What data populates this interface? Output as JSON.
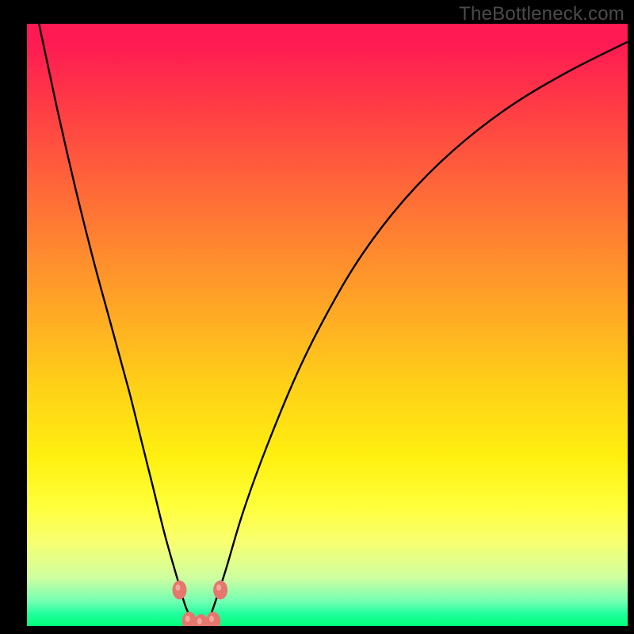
{
  "watermark": {
    "text": "TheBottleneck.com"
  },
  "chart_data": {
    "type": "line",
    "title": "",
    "xlabel": "",
    "ylabel": "",
    "xlim": [
      0,
      100
    ],
    "ylim": [
      0,
      100
    ],
    "series": [
      {
        "name": "bottleneck-curve",
        "x": [
          0,
          2,
          5,
          8,
          11,
          14,
          17,
          19,
          21,
          23,
          25,
          26.5,
          28,
          29,
          30,
          31,
          33,
          36,
          40,
          45,
          50,
          56,
          63,
          71,
          80,
          90,
          100
        ],
        "y": [
          110,
          100,
          86,
          73,
          61,
          50,
          39,
          31,
          23,
          15,
          8,
          3,
          0.5,
          0,
          0.5,
          3,
          9,
          19,
          30,
          42,
          52,
          62,
          71,
          79,
          86,
          92,
          97
        ]
      }
    ],
    "markers": [
      {
        "name": "left-shoulder-top",
        "x": 25.4,
        "y": 6.0
      },
      {
        "name": "right-shoulder-top",
        "x": 32.2,
        "y": 6.0
      },
      {
        "name": "left-foot",
        "x": 27.0,
        "y": 0.8
      },
      {
        "name": "mid-foot",
        "x": 29.0,
        "y": 0.4
      },
      {
        "name": "right-foot",
        "x": 31.0,
        "y": 0.8
      }
    ],
    "gradient_note": "vertical red→green heatmap, green=0 bottleneck"
  }
}
